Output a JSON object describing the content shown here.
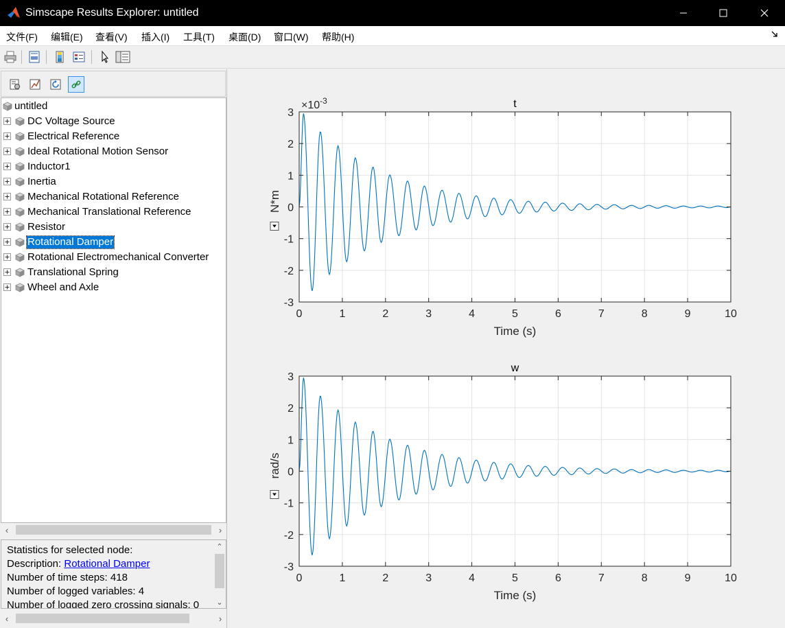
{
  "window": {
    "title": "Simscape Results Explorer: untitled",
    "minimize_icon": "minimize-icon",
    "maximize_icon": "maximize-icon",
    "close_icon": "close-icon"
  },
  "menu": {
    "items": [
      "文件(F)",
      "编辑(E)",
      "查看(V)",
      "插入(I)",
      "工具(T)",
      "桌面(D)",
      "窗口(W)",
      "帮助(H)"
    ],
    "dock_icon": "dock-arrow-icon"
  },
  "toolbar": {
    "icons": [
      "print-icon",
      "print-preview-icon",
      "colorbar-icon",
      "legend-icon",
      "pointer-icon",
      "property-editor-icon"
    ]
  },
  "left_toolbar": {
    "icons": [
      "options-icon",
      "plot-icon",
      "refresh-icon",
      "link-icon"
    ]
  },
  "tree": {
    "root": "untitled",
    "items": [
      {
        "label": "DC Voltage Source",
        "selected": false
      },
      {
        "label": "Electrical Reference",
        "selected": false
      },
      {
        "label": "Ideal Rotational Motion Sensor",
        "selected": false
      },
      {
        "label": "Inductor1",
        "selected": false
      },
      {
        "label": "Inertia",
        "selected": false
      },
      {
        "label": "Mechanical Rotational Reference",
        "selected": false
      },
      {
        "label": "Mechanical Translational Reference",
        "selected": false
      },
      {
        "label": "Resistor",
        "selected": false
      },
      {
        "label": "Rotational Damper",
        "selected": true
      },
      {
        "label": "Rotational Electromechanical Converter",
        "selected": false
      },
      {
        "label": "Translational Spring",
        "selected": false
      },
      {
        "label": "Wheel and Axle",
        "selected": false
      }
    ]
  },
  "stats": {
    "heading": "Statistics for selected node:",
    "description_label": "Description: ",
    "description_link": "Rotational Damper",
    "time_steps": "Number of time steps: 418",
    "logged_variables": "Number of logged variables: 4",
    "zero_crossing": "Number of logged zero crossing signals: 0"
  },
  "colors": {
    "line": "#0072bd",
    "selection": "#0078d7",
    "grid": "#e3e3e3"
  },
  "chart_data": [
    {
      "type": "line",
      "title": "t",
      "xlabel": "Time (s)",
      "ylabel": "N*m",
      "exponent_label": "×10",
      "exponent_power": "-3",
      "xlim": [
        0,
        10
      ],
      "ylim": [
        -3,
        3
      ],
      "xticks": [
        "0",
        "1",
        "2",
        "3",
        "4",
        "5",
        "6",
        "7",
        "8",
        "9",
        "10"
      ],
      "yticks": [
        "3",
        "2",
        "1",
        "0",
        "-1",
        "-2",
        "-3"
      ],
      "grid": true,
      "series": [
        {
          "x": [
            0,
            0.1,
            0.3,
            0.49,
            0.7,
            0.9,
            1.1,
            1.3,
            1.51,
            1.71,
            1.9,
            2.1,
            2.31,
            2.51,
            2.71,
            2.9,
            3.1,
            3.31,
            3.51,
            3.7,
            3.9,
            4.1,
            4.31,
            4.51,
            4.7,
            4.9,
            5.1,
            5.31,
            5.5,
            5.7,
            5.9,
            6.1,
            6.31,
            6.5,
            6.7,
            6.9,
            7.1,
            7.3,
            7.5,
            7.7,
            7.9,
            8.1,
            8.3,
            8.5,
            8.7,
            8.9,
            9.1,
            9.3,
            9.5,
            9.7,
            9.9,
            10
          ],
          "y": [
            0,
            2.95,
            -2.65,
            2.38,
            -2.13,
            1.93,
            -1.73,
            1.55,
            -1.39,
            1.26,
            -1.12,
            1.01,
            -0.91,
            0.82,
            -0.73,
            0.66,
            -0.59,
            0.53,
            -0.48,
            0.43,
            -0.38,
            0.35,
            -0.31,
            0.28,
            -0.25,
            0.23,
            -0.2,
            0.18,
            -0.16,
            0.15,
            -0.13,
            0.12,
            -0.11,
            0.1,
            -0.09,
            0.08,
            -0.07,
            0.07,
            -0.06,
            0.05,
            -0.05,
            0.05,
            -0.04,
            0.04,
            -0.04,
            0.03,
            -0.03,
            0.03,
            -0.03,
            0.03,
            -0.02,
            0
          ]
        }
      ]
    },
    {
      "type": "line",
      "title": "w",
      "xlabel": "Time (s)",
      "ylabel": "rad/s",
      "xlim": [
        0,
        10
      ],
      "ylim": [
        -3,
        3
      ],
      "xticks": [
        "0",
        "1",
        "2",
        "3",
        "4",
        "5",
        "6",
        "7",
        "8",
        "9",
        "10"
      ],
      "yticks": [
        "3",
        "2",
        "1",
        "0",
        "-1",
        "-2",
        "-3"
      ],
      "grid": true,
      "series": [
        {
          "x": [
            0,
            0.1,
            0.3,
            0.49,
            0.7,
            0.9,
            1.1,
            1.3,
            1.51,
            1.71,
            1.9,
            2.1,
            2.31,
            2.51,
            2.71,
            2.9,
            3.1,
            3.31,
            3.51,
            3.7,
            3.9,
            4.1,
            4.31,
            4.51,
            4.7,
            4.9,
            5.1,
            5.31,
            5.5,
            5.7,
            5.9,
            6.1,
            6.31,
            6.5,
            6.7,
            6.9,
            7.1,
            7.3,
            7.5,
            7.7,
            7.9,
            8.1,
            8.3,
            8.5,
            8.7,
            8.9,
            9.1,
            9.3,
            9.5,
            9.7,
            9.9,
            10
          ],
          "y": [
            0,
            2.95,
            -2.65,
            2.38,
            -2.13,
            1.93,
            -1.73,
            1.55,
            -1.39,
            1.26,
            -1.12,
            1.01,
            -0.91,
            0.82,
            -0.73,
            0.66,
            -0.59,
            0.53,
            -0.48,
            0.43,
            -0.38,
            0.35,
            -0.31,
            0.28,
            -0.25,
            0.23,
            -0.2,
            0.18,
            -0.16,
            0.15,
            -0.13,
            0.12,
            -0.11,
            0.1,
            -0.09,
            0.08,
            -0.07,
            0.07,
            -0.06,
            0.05,
            -0.05,
            0.05,
            -0.04,
            0.04,
            -0.04,
            0.03,
            -0.03,
            0.03,
            -0.03,
            0.03,
            -0.02,
            0
          ]
        }
      ]
    }
  ]
}
